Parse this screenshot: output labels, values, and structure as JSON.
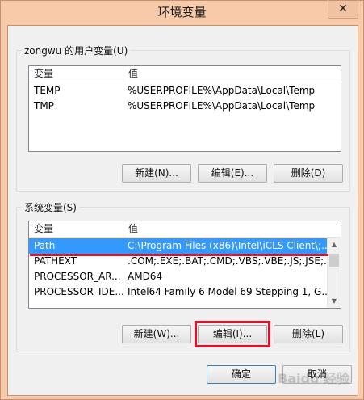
{
  "window": {
    "title": "环境变量",
    "close_glyph": "✕"
  },
  "user_vars": {
    "group_label": "zongwu 的用户变量(U)",
    "columns": [
      "变量",
      "值"
    ],
    "rows": [
      {
        "name": "TEMP",
        "value": "%USERPROFILE%\\AppData\\Local\\Temp"
      },
      {
        "name": "TMP",
        "value": "%USERPROFILE%\\AppData\\Local\\Temp"
      }
    ],
    "buttons": {
      "new": "新建(N)...",
      "edit": "编辑(E)...",
      "delete": "删除(D)"
    }
  },
  "system_vars": {
    "group_label": "系统变量(S)",
    "columns": [
      "变量",
      "值"
    ],
    "rows": [
      {
        "name": "Path",
        "value": "C:\\Program Files (x86)\\Intel\\iCLS Client\\;...",
        "selected": true
      },
      {
        "name": "PATHEXT",
        "value": ".COM;.EXE;.BAT;.CMD;.VBS;.VBE;.JS;.JSE;..."
      },
      {
        "name": "PROCESSOR_AR...",
        "value": "AMD64"
      },
      {
        "name": "PROCESSOR_IDE...",
        "value": "Intel64 Family 6 Model 69 Stepping 1, G..."
      }
    ],
    "buttons": {
      "new": "新建(W)...",
      "edit": "编辑(I)...",
      "delete": "删除(L)"
    }
  },
  "footer": {
    "ok": "确定",
    "cancel": "取消"
  },
  "watermark": "Baidu 经验",
  "colors": {
    "selection": "#3399ff",
    "annotation_red": "#e0102a",
    "title_bar": "#f7cba9"
  }
}
